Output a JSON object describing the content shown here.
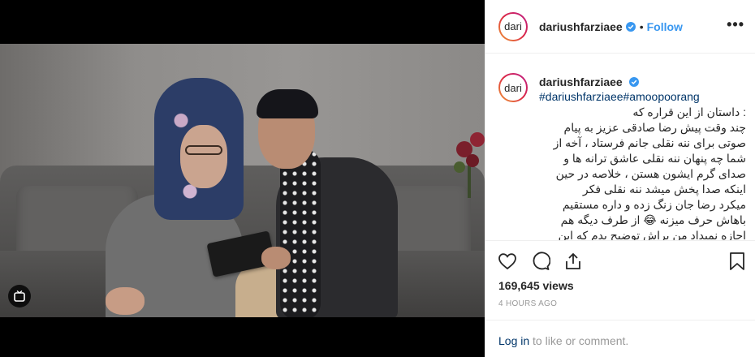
{
  "post": {
    "username": "dariushfarziaee",
    "avatar_text": "dari",
    "follow_label": "Follow",
    "separator": "•",
    "more_label": "•••",
    "caption": {
      "username": "dariushfarziaee",
      "hashtags": "#dariushfarziaee#amoopoorang",
      "text": ": داستان از این قراره که\nچند وقت پیش رضا صادقی عزیز به پیام\nصوتی برای ننه نقلی جانم فرستاد ، آخه از\nشما چه پنهان ننه نقلی عاشق ترانه ها و\nصدای گرم ایشون هستن ، خلاصه در حین\nاینکه صدا پخش میشد ننه نقلی فکر\nمیکرد رضا جان زنگ زده و داره مستقیم\nباهاش حرف میزنه 😂 از طرف دیگه هم\nاجازه نمیداد من براش توضیح بدم که این"
    },
    "views": "169,645 views",
    "time_ago": "4 HOURS AGO"
  },
  "login_bar": {
    "link": "Log in",
    "text": " to like or comment."
  },
  "icons": {
    "verified": "verified-badge-icon",
    "like": "heart-icon",
    "comment": "comment-bubble-icon",
    "share": "share-icon",
    "save": "bookmark-icon",
    "igtv": "igtv-icon"
  },
  "colors": {
    "link_blue": "#3897f0",
    "hashtag_blue": "#003569",
    "verified_blue": "#3897f0",
    "muted": "#999999"
  }
}
